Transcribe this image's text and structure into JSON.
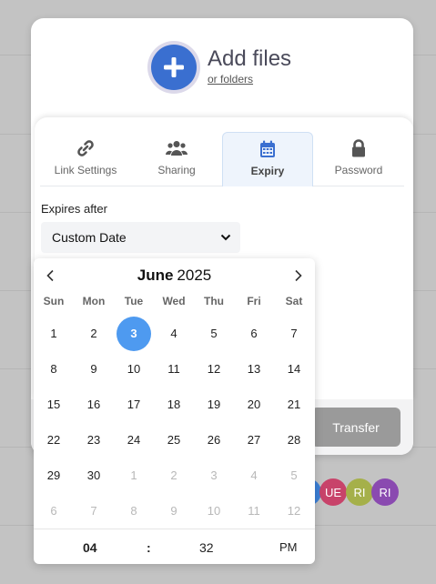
{
  "add_files": {
    "title": "Add files",
    "subtitle": "or folders"
  },
  "tabs": [
    {
      "label": "Link Settings",
      "icon": "link-icon",
      "active": false
    },
    {
      "label": "Sharing",
      "icon": "users-icon",
      "active": false
    },
    {
      "label": "Expiry",
      "icon": "calendar-icon",
      "active": true
    },
    {
      "label": "Password",
      "icon": "lock-icon",
      "active": false
    }
  ],
  "expiry": {
    "label": "Expires after",
    "selected_option": "Custom Date"
  },
  "calendar": {
    "month": "June",
    "year": "2025",
    "weekdays": [
      "Sun",
      "Mon",
      "Tue",
      "Wed",
      "Thu",
      "Fri",
      "Sat"
    ],
    "weeks": [
      [
        "1",
        "2",
        "3",
        "4",
        "5",
        "6",
        "7"
      ],
      [
        "8",
        "9",
        "10",
        "11",
        "12",
        "13",
        "14"
      ],
      [
        "15",
        "16",
        "17",
        "18",
        "19",
        "20",
        "21"
      ],
      [
        "22",
        "23",
        "24",
        "25",
        "26",
        "27",
        "28"
      ],
      [
        "29",
        "30",
        "1",
        "2",
        "3",
        "4",
        "5"
      ],
      [
        "6",
        "7",
        "8",
        "9",
        "10",
        "11",
        "12"
      ]
    ],
    "selected_day": "3",
    "hour": "04",
    "separator": ":",
    "minute": "32",
    "meridiem": "PM"
  },
  "transfer_label": "Transfer",
  "avatars": [
    {
      "initials": "",
      "color": "#3b7fd6"
    },
    {
      "initials": "UE",
      "color": "#c8436a"
    },
    {
      "initials": "RI",
      "color": "#a5b04a"
    },
    {
      "initials": "RI",
      "color": "#8a4ab0"
    }
  ],
  "colors": {
    "accent": "#3a6fd0",
    "selected_day": "#4e9af0",
    "transfer_button": "#9a9a9a"
  }
}
